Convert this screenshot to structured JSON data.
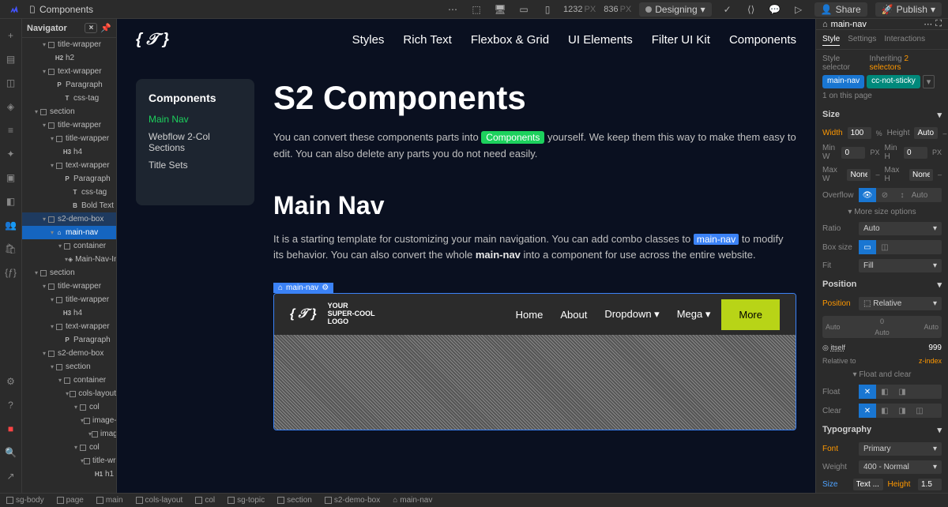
{
  "topbar": {
    "page_name": "Components",
    "dims": {
      "w": "1232",
      "h": "836",
      "unit": "PX"
    },
    "designing": "Designing",
    "share": "Share",
    "publish": "Publish"
  },
  "navigator": {
    "title": "Navigator",
    "close": "×",
    "tree": [
      {
        "d": 2,
        "t": "title-wrapper",
        "i": "box"
      },
      {
        "d": 3,
        "t": "h2",
        "i": "H2",
        "raw": true
      },
      {
        "d": 2,
        "t": "text-wrapper",
        "i": "box"
      },
      {
        "d": 3,
        "t": "Paragraph",
        "i": "P",
        "raw": true
      },
      {
        "d": 4,
        "t": "css-tag",
        "i": "T",
        "raw": true
      },
      {
        "d": 1,
        "t": "section",
        "i": "box"
      },
      {
        "d": 2,
        "t": "title-wrapper",
        "i": "box"
      },
      {
        "d": 3,
        "t": "title-wrapper",
        "i": "box"
      },
      {
        "d": 4,
        "t": "h4",
        "i": "H3",
        "raw": true
      },
      {
        "d": 3,
        "t": "text-wrapper",
        "i": "box"
      },
      {
        "d": 4,
        "t": "Paragraph",
        "i": "P",
        "raw": true
      },
      {
        "d": 5,
        "t": "css-tag",
        "i": "T",
        "raw": true
      },
      {
        "d": 5,
        "t": "Bold Text",
        "i": "B",
        "raw": true
      },
      {
        "d": 2,
        "t": "s2-demo-box",
        "i": "box",
        "hilite": true
      },
      {
        "d": 3,
        "t": "main-nav",
        "i": "home",
        "selected": true
      },
      {
        "d": 4,
        "t": "container",
        "i": "box"
      },
      {
        "d": 5,
        "t": "Main-Nav-Inn",
        "i": "sym",
        "green": true
      },
      {
        "d": 1,
        "t": "section",
        "i": "box"
      },
      {
        "d": 2,
        "t": "title-wrapper",
        "i": "box"
      },
      {
        "d": 3,
        "t": "title-wrapper",
        "i": "box"
      },
      {
        "d": 4,
        "t": "h4",
        "i": "H3",
        "raw": true
      },
      {
        "d": 3,
        "t": "text-wrapper",
        "i": "box"
      },
      {
        "d": 4,
        "t": "Paragraph",
        "i": "P",
        "raw": true
      },
      {
        "d": 2,
        "t": "s2-demo-box",
        "i": "box"
      },
      {
        "d": 3,
        "t": "section",
        "i": "box"
      },
      {
        "d": 4,
        "t": "container",
        "i": "box"
      },
      {
        "d": 5,
        "t": "cols-layout",
        "i": "box"
      },
      {
        "d": 6,
        "t": "col",
        "i": "box"
      },
      {
        "d": 7,
        "t": "image-wr",
        "i": "box"
      },
      {
        "d": 8,
        "t": "image",
        "i": "box"
      },
      {
        "d": 6,
        "t": "col",
        "i": "box"
      },
      {
        "d": 7,
        "t": "title-wrapper",
        "i": "box"
      },
      {
        "d": 8,
        "t": "h1",
        "i": "H1",
        "raw": true
      }
    ]
  },
  "canvas": {
    "logo": "{ 𝒯 }",
    "nav": [
      "Styles",
      "Rich Text",
      "Flexbox & Grid",
      "UI Elements",
      "Filter UI Kit",
      "Components"
    ],
    "sidebar": {
      "title": "Components",
      "items": [
        "Main Nav",
        "Webflow 2-Col Sections",
        "Title Sets"
      ],
      "active": 0
    },
    "h1": "S2 Components",
    "p1a": "You can convert these components parts into ",
    "p1tag": "Components",
    "p1b": " yourself. We keep them this way to make them easy to edit. You can also delete any parts you do not need easily.",
    "h2": "Main Nav",
    "p2a": "It is a starting template for customizing your main navigation. You can add combo classes to ",
    "p2tag": "main-nav",
    "p2b": " to modify its behavior. You can also convert the whole ",
    "p2bold": "main-nav",
    "p2c": " into a component for use across the entire website.",
    "sel_label": "main-nav",
    "preview": {
      "logo": "{ 𝒯 }",
      "logo_text1": "YOUR",
      "logo_text2": "SUPER-COOL",
      "logo_text3": "LOGO",
      "menu": [
        "Home",
        "About",
        "Dropdown",
        "Mega"
      ],
      "more": "More"
    }
  },
  "right": {
    "element": "main-nav",
    "tabs": [
      "Style",
      "Settings",
      "Interactions"
    ],
    "selector_label": "Style selector",
    "inheriting": "Inheriting",
    "inheriting_count": "2 selectors",
    "badges": [
      "main-nav",
      "cc-not-sticky"
    ],
    "on_page": "1 on this page",
    "size": {
      "title": "Size",
      "width_l": "Width",
      "width_v": "100",
      "width_u": "%",
      "height_l": "Height",
      "height_v": "Auto",
      "minw_l": "Min W",
      "minw_v": "0",
      "minw_u": "PX",
      "minh_l": "Min H",
      "minh_v": "0",
      "minh_u": "PX",
      "maxw_l": "Max W",
      "maxw_v": "None",
      "maxw_u": "–",
      "maxh_l": "Max H",
      "maxh_v": "None",
      "maxh_u": "–",
      "overflow_l": "Overflow",
      "more": "More size options",
      "ratio_l": "Ratio",
      "ratio_v": "Auto",
      "boxsize_l": "Box size",
      "fit_l": "Fit",
      "fit_v": "Fill"
    },
    "position": {
      "title": "Position",
      "pos_l": "Position",
      "pos_v": "Relative",
      "top": "0",
      "left": "Auto",
      "right": "Auto",
      "bottom": "Auto",
      "rel_to": "Relative to",
      "itself": "itself",
      "val": "999",
      "zindex": "z-index",
      "floatclear": "Float and clear",
      "float_l": "Float",
      "clear_l": "Clear"
    },
    "typo": {
      "title": "Typography",
      "font_l": "Font",
      "font_v": "Primary",
      "weight_l": "Weight",
      "weight_v": "400 - Normal",
      "size_l": "Size",
      "size_v": "Text ...",
      "height_l": "Height",
      "height_v": "1.5"
    },
    "auto": "Auto"
  },
  "breadcrumb": [
    "sg-body",
    "page",
    "main",
    "cols-layout",
    "col",
    "sg-topic",
    "section",
    "s2-demo-box",
    "main-nav"
  ]
}
